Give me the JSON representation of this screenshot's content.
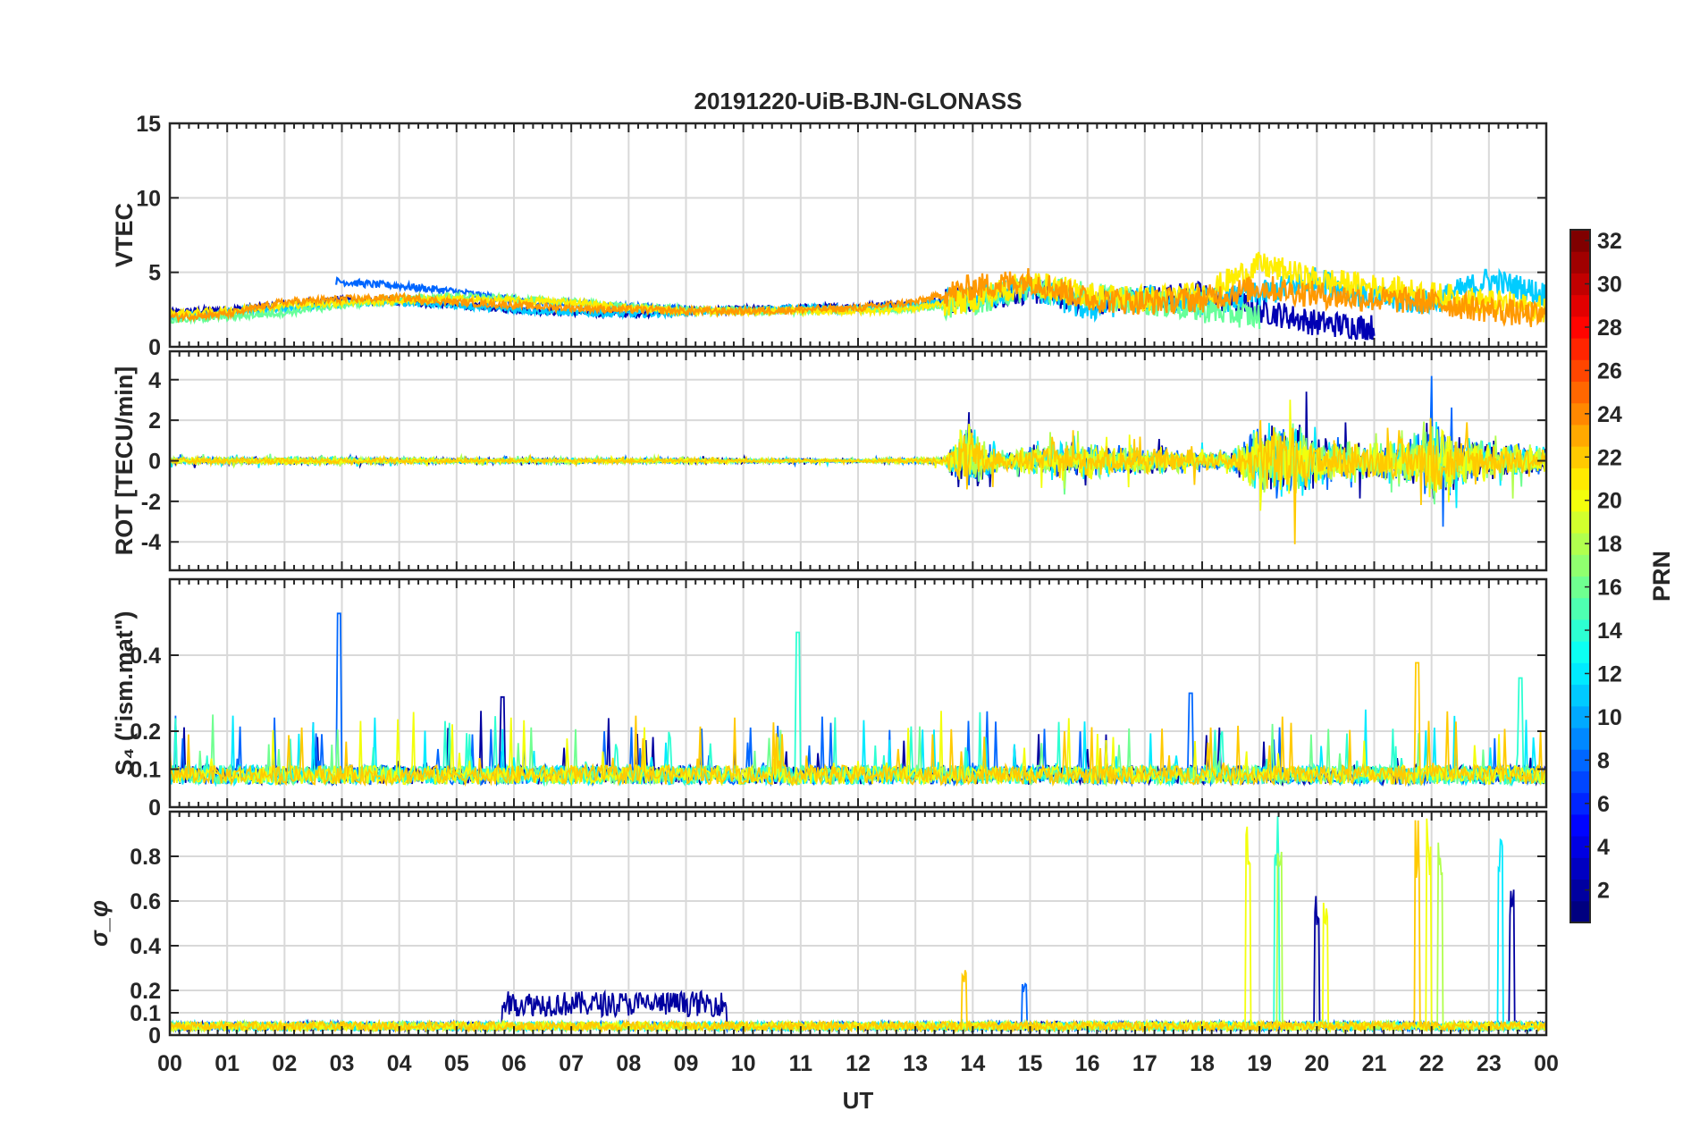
{
  "figure": {
    "title": "20191220-UiB-BJN-GLONASS",
    "xlabel": "UT",
    "x_tick_labels": [
      "00",
      "01",
      "02",
      "03",
      "04",
      "05",
      "06",
      "07",
      "08",
      "09",
      "10",
      "11",
      "12",
      "13",
      "14",
      "15",
      "16",
      "17",
      "18",
      "19",
      "20",
      "21",
      "22",
      "23",
      "00"
    ]
  },
  "colorbar": {
    "label": "PRN",
    "range": [
      1,
      32
    ],
    "tick_labels": [
      "2",
      "4",
      "6",
      "8",
      "10",
      "12",
      "14",
      "16",
      "18",
      "20",
      "22",
      "24",
      "26",
      "28",
      "30",
      "32"
    ],
    "colormap": "jet"
  },
  "chart_data": [
    {
      "type": "line",
      "ylabel": "VTEC",
      "xlim": [
        0,
        24
      ],
      "ylim": [
        0,
        15
      ],
      "y_ticks": [
        0,
        5,
        10,
        15
      ],
      "y_tick_labels": [
        "0",
        "5",
        "10",
        "15"
      ],
      "grid": true,
      "series": [
        {
          "prn": 2,
          "color": "#0000b3",
          "x": [
            0,
            1,
            2,
            3,
            4,
            5,
            6,
            7,
            8,
            9,
            10,
            11,
            12,
            13,
            14,
            15,
            16,
            17,
            18,
            19,
            20,
            21
          ],
          "values": [
            2.3,
            2.5,
            2.8,
            3.2,
            3.0,
            2.8,
            2.5,
            2.3,
            2.2,
            2.4,
            2.5,
            2.6,
            2.7,
            2.9,
            3.2,
            3.8,
            3.0,
            3.3,
            3.5,
            2.5,
            1.6,
            1.3
          ]
        },
        {
          "prn": 8,
          "color": "#0066ff",
          "x": [
            2.9,
            3.5,
            4,
            4.5,
            5,
            5.5,
            6,
            6.5,
            7,
            7.5,
            8,
            8.5,
            9
          ],
          "values": [
            4.4,
            4.2,
            4.1,
            3.9,
            3.7,
            3.4,
            3.2,
            3.0,
            2.9,
            2.8,
            2.7,
            2.6,
            2.5
          ]
        },
        {
          "prn": 12,
          "color": "#00ccff",
          "x": [
            0,
            1,
            2,
            3,
            4,
            5,
            6,
            7,
            8,
            9,
            10,
            11,
            12,
            13,
            14,
            15,
            16,
            17,
            18,
            19,
            20,
            21,
            22,
            23,
            24
          ],
          "values": [
            2.0,
            2.3,
            2.6,
            2.9,
            3.0,
            2.8,
            2.5,
            2.3,
            2.2,
            2.3,
            2.5,
            2.6,
            2.5,
            2.8,
            3.2,
            4.0,
            2.5,
            3.3,
            3.0,
            3.5,
            4.5,
            3.2,
            3.0,
            4.5,
            3.5
          ]
        },
        {
          "prn": 16,
          "color": "#66ff99",
          "x": [
            0,
            1,
            2,
            3,
            4,
            5,
            6,
            7,
            8,
            9,
            10,
            11,
            12,
            13,
            14,
            15,
            16,
            17,
            18,
            19
          ],
          "values": [
            1.8,
            2.0,
            2.3,
            2.8,
            3.2,
            3.4,
            3.2,
            3.0,
            2.7,
            2.5,
            2.4,
            2.4,
            2.5,
            2.6,
            3.0,
            4.0,
            3.5,
            3.0,
            2.5,
            2.0
          ]
        },
        {
          "prn": 20,
          "color": "#ffee00",
          "x": [
            0,
            1,
            2,
            3,
            4,
            5,
            6,
            7,
            8,
            9,
            10,
            11,
            12,
            13,
            14,
            15,
            16,
            17,
            18,
            19,
            20,
            21,
            22,
            23,
            24
          ],
          "values": [
            2.2,
            2.4,
            2.8,
            3.0,
            3.1,
            3.2,
            3.1,
            3.0,
            2.6,
            2.4,
            2.4,
            2.4,
            2.4,
            2.6,
            3.2,
            4.3,
            3.5,
            3.2,
            3.5,
            5.5,
            4.5,
            4.0,
            3.5,
            3.0,
            2.5
          ]
        },
        {
          "prn": 22,
          "color": "#ff9900",
          "x": [
            0,
            1,
            2,
            3,
            4,
            5,
            6,
            7,
            8,
            9,
            10,
            11,
            12,
            13,
            14,
            15,
            16,
            17,
            18,
            19,
            20,
            21,
            22,
            23,
            24
          ],
          "values": [
            2.0,
            2.2,
            3.0,
            3.2,
            3.3,
            3.0,
            2.8,
            2.6,
            2.5,
            2.4,
            2.4,
            2.5,
            2.6,
            3.0,
            4.0,
            4.5,
            3.2,
            3.0,
            3.2,
            4.0,
            3.5,
            3.2,
            3.0,
            2.5,
            2.0
          ]
        }
      ]
    },
    {
      "type": "line",
      "ylabel": "ROT [TECU/min]",
      "xlim": [
        0,
        24
      ],
      "ylim": [
        -5.4,
        5.4
      ],
      "y_ticks": [
        -4,
        -2,
        0,
        2,
        4
      ],
      "y_tick_labels": [
        "-4",
        "-2",
        "0",
        "2",
        "4"
      ],
      "grid": true,
      "envelope": {
        "x": [
          0,
          3,
          6,
          9,
          12,
          13.5,
          13.9,
          14.5,
          15.5,
          17,
          18.5,
          19,
          19.5,
          20,
          21,
          21.8,
          22,
          22.5,
          23,
          24
        ],
        "amplitude": [
          0.4,
          0.4,
          0.3,
          0.3,
          0.2,
          0.4,
          4.5,
          1.0,
          2.2,
          1.5,
          1.0,
          4.0,
          5.0,
          3.0,
          2.0,
          3.0,
          5.0,
          3.0,
          2.5,
          1.5
        ]
      }
    },
    {
      "type": "line",
      "ylabel": "S₄ (\"ism.mat\")",
      "xlim": [
        0,
        24
      ],
      "ylim": [
        0,
        0.6
      ],
      "y_ticks": [
        0,
        0.1,
        0.2,
        0.4
      ],
      "y_tick_labels": [
        "0",
        "0.1",
        "0.2",
        "0.4"
      ],
      "grid": true,
      "baseline": 0.06,
      "peaks": [
        {
          "x": 2.95,
          "value": 0.51,
          "prn": 8
        },
        {
          "x": 10.95,
          "value": 0.46,
          "prn": 14
        },
        {
          "x": 21.75,
          "value": 0.38,
          "prn": 22
        },
        {
          "x": 23.55,
          "value": 0.34,
          "prn": 14
        },
        {
          "x": 5.8,
          "value": 0.29,
          "prn": 2
        },
        {
          "x": 9.0,
          "value": 0.28,
          "prn": 18
        },
        {
          "x": 17.8,
          "value": 0.3,
          "prn": 8
        }
      ]
    },
    {
      "type": "line",
      "ylabel": "σ_φ",
      "xlim": [
        0,
        24
      ],
      "ylim": [
        0,
        1.0
      ],
      "y_ticks": [
        0,
        0.1,
        0.2,
        0.4,
        0.6,
        0.8
      ],
      "y_tick_labels": [
        "0",
        "0.1",
        "0.2",
        "0.4",
        "0.6",
        "0.8"
      ],
      "grid": true,
      "baseline": 0.04,
      "elevated_segment": {
        "x": [
          5.8,
          9.7
        ],
        "value": 0.14,
        "prn": 2
      },
      "peaks": [
        {
          "x": 18.8,
          "value": 1.0,
          "prn": 20
        },
        {
          "x": 19.3,
          "value": 1.0,
          "prn": 14
        },
        {
          "x": 19.35,
          "value": 0.98,
          "prn": 18
        },
        {
          "x": 20.0,
          "value": 0.67,
          "prn": 2
        },
        {
          "x": 20.15,
          "value": 0.7,
          "prn": 20
        },
        {
          "x": 21.75,
          "value": 1.0,
          "prn": 22
        },
        {
          "x": 21.95,
          "value": 1.0,
          "prn": 20
        },
        {
          "x": 22.15,
          "value": 1.0,
          "prn": 18
        },
        {
          "x": 23.2,
          "value": 1.0,
          "prn": 12
        },
        {
          "x": 23.4,
          "value": 0.68,
          "prn": 2
        },
        {
          "x": 13.85,
          "value": 0.3,
          "prn": 22
        },
        {
          "x": 14.9,
          "value": 0.23,
          "prn": 8
        }
      ]
    }
  ]
}
